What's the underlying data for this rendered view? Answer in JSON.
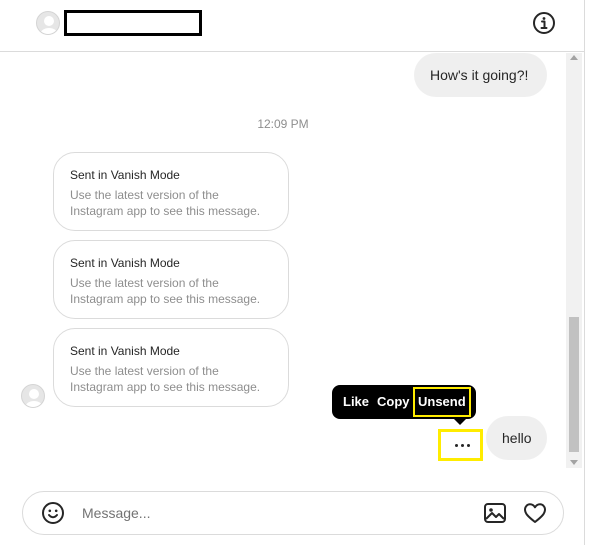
{
  "header": {
    "info_icon": "info-icon",
    "avatar_icon": "user-avatar-placeholder"
  },
  "thread": {
    "outgoing_top": "How's it going?!",
    "timestamp": "12:09 PM",
    "vanish_messages": [
      {
        "title": "Sent in Vanish Mode",
        "body": "Use the latest version of the Instagram app to see this message."
      },
      {
        "title": "Sent in Vanish Mode",
        "body": "Use the latest version of the Instagram app to see this message."
      },
      {
        "title": "Sent in Vanish Mode",
        "body": "Use the latest version of the Instagram app to see this message."
      }
    ],
    "outgoing_bottom": "hello"
  },
  "message_menu": {
    "like": "Like",
    "copy": "Copy",
    "unsend": "Unsend",
    "highlight_color": "#ffec00"
  },
  "more_options_icon": "more-horizontal-icon",
  "composer": {
    "placeholder": "Message...",
    "emoji_icon": "emoji-icon",
    "image_icon": "image-icon",
    "heart_icon": "heart-icon"
  },
  "colors": {
    "bubble_bg": "#efefef",
    "border": "#dbdbdb",
    "muted_text": "#8e8e8e"
  }
}
